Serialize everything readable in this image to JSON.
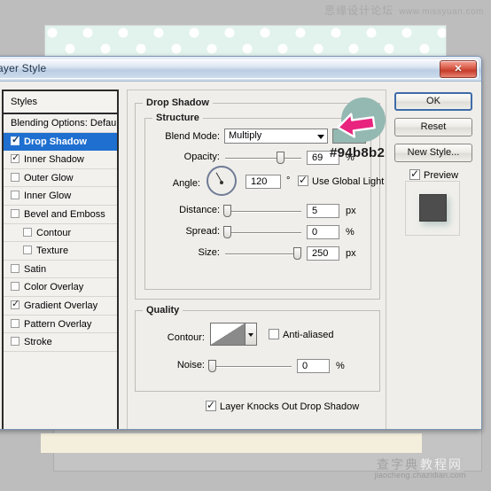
{
  "watermarks": {
    "top_cn": "思缘设计论坛",
    "top_url": "www.missyuan.com",
    "bottom_cn_1": "查字典",
    "bottom_cn_2": "教程网",
    "bottom_url": "jiaocheng.chazidian.com"
  },
  "dialog": {
    "title": "ayer Style",
    "close_label": "✕"
  },
  "styles_panel": {
    "header": "Styles",
    "items": [
      {
        "label": "Blending Options: Default",
        "checkbox": "none",
        "indent": false,
        "selected": false
      },
      {
        "label": "Drop Shadow",
        "checkbox": "checked",
        "indent": false,
        "selected": true
      },
      {
        "label": "Inner Shadow",
        "checkbox": "checked",
        "indent": false,
        "selected": false
      },
      {
        "label": "Outer Glow",
        "checkbox": "unchecked",
        "indent": false,
        "selected": false
      },
      {
        "label": "Inner Glow",
        "checkbox": "unchecked",
        "indent": false,
        "selected": false
      },
      {
        "label": "Bevel and Emboss",
        "checkbox": "unchecked",
        "indent": false,
        "selected": false
      },
      {
        "label": "Contour",
        "checkbox": "unchecked",
        "indent": true,
        "selected": false
      },
      {
        "label": "Texture",
        "checkbox": "unchecked",
        "indent": true,
        "selected": false
      },
      {
        "label": "Satin",
        "checkbox": "unchecked",
        "indent": false,
        "selected": false
      },
      {
        "label": "Color Overlay",
        "checkbox": "unchecked",
        "indent": false,
        "selected": false
      },
      {
        "label": "Gradient Overlay",
        "checkbox": "checked",
        "indent": false,
        "selected": false
      },
      {
        "label": "Pattern Overlay",
        "checkbox": "unchecked",
        "indent": false,
        "selected": false
      },
      {
        "label": "Stroke",
        "checkbox": "unchecked",
        "indent": false,
        "selected": false
      }
    ]
  },
  "drop_shadow": {
    "group_title": "Drop Shadow",
    "structure": {
      "group_title": "Structure",
      "blend_mode_label": "Blend Mode:",
      "blend_mode_value": "Multiply",
      "shadow_color": "#94b8b2",
      "opacity_label": "Opacity:",
      "opacity_value": "69",
      "opacity_unit": "%",
      "angle_label": "Angle:",
      "angle_value": "120",
      "angle_unit": "°",
      "use_global_light_label": "Use Global Light",
      "use_global_light_checked": true,
      "distance_label": "Distance:",
      "distance_value": "5",
      "distance_unit": "px",
      "spread_label": "Spread:",
      "spread_value": "0",
      "spread_unit": "%",
      "size_label": "Size:",
      "size_value": "250",
      "size_unit": "px"
    },
    "quality": {
      "group_title": "Quality",
      "contour_label": "Contour:",
      "anti_aliased_label": "Anti-aliased",
      "anti_aliased_checked": false,
      "noise_label": "Noise:",
      "noise_value": "0",
      "noise_unit": "%"
    },
    "layer_knocks_out_label": "Layer Knocks Out Drop Shadow",
    "layer_knocks_out_checked": true
  },
  "buttons": {
    "ok": "OK",
    "reset": "Reset",
    "new_style": "New Style...",
    "preview_label": "Preview",
    "preview_checked": true
  },
  "annotation": {
    "hex_text": "#94b8b2",
    "circle_color": "#94b8b2",
    "arrow_color": "#e8247e"
  }
}
